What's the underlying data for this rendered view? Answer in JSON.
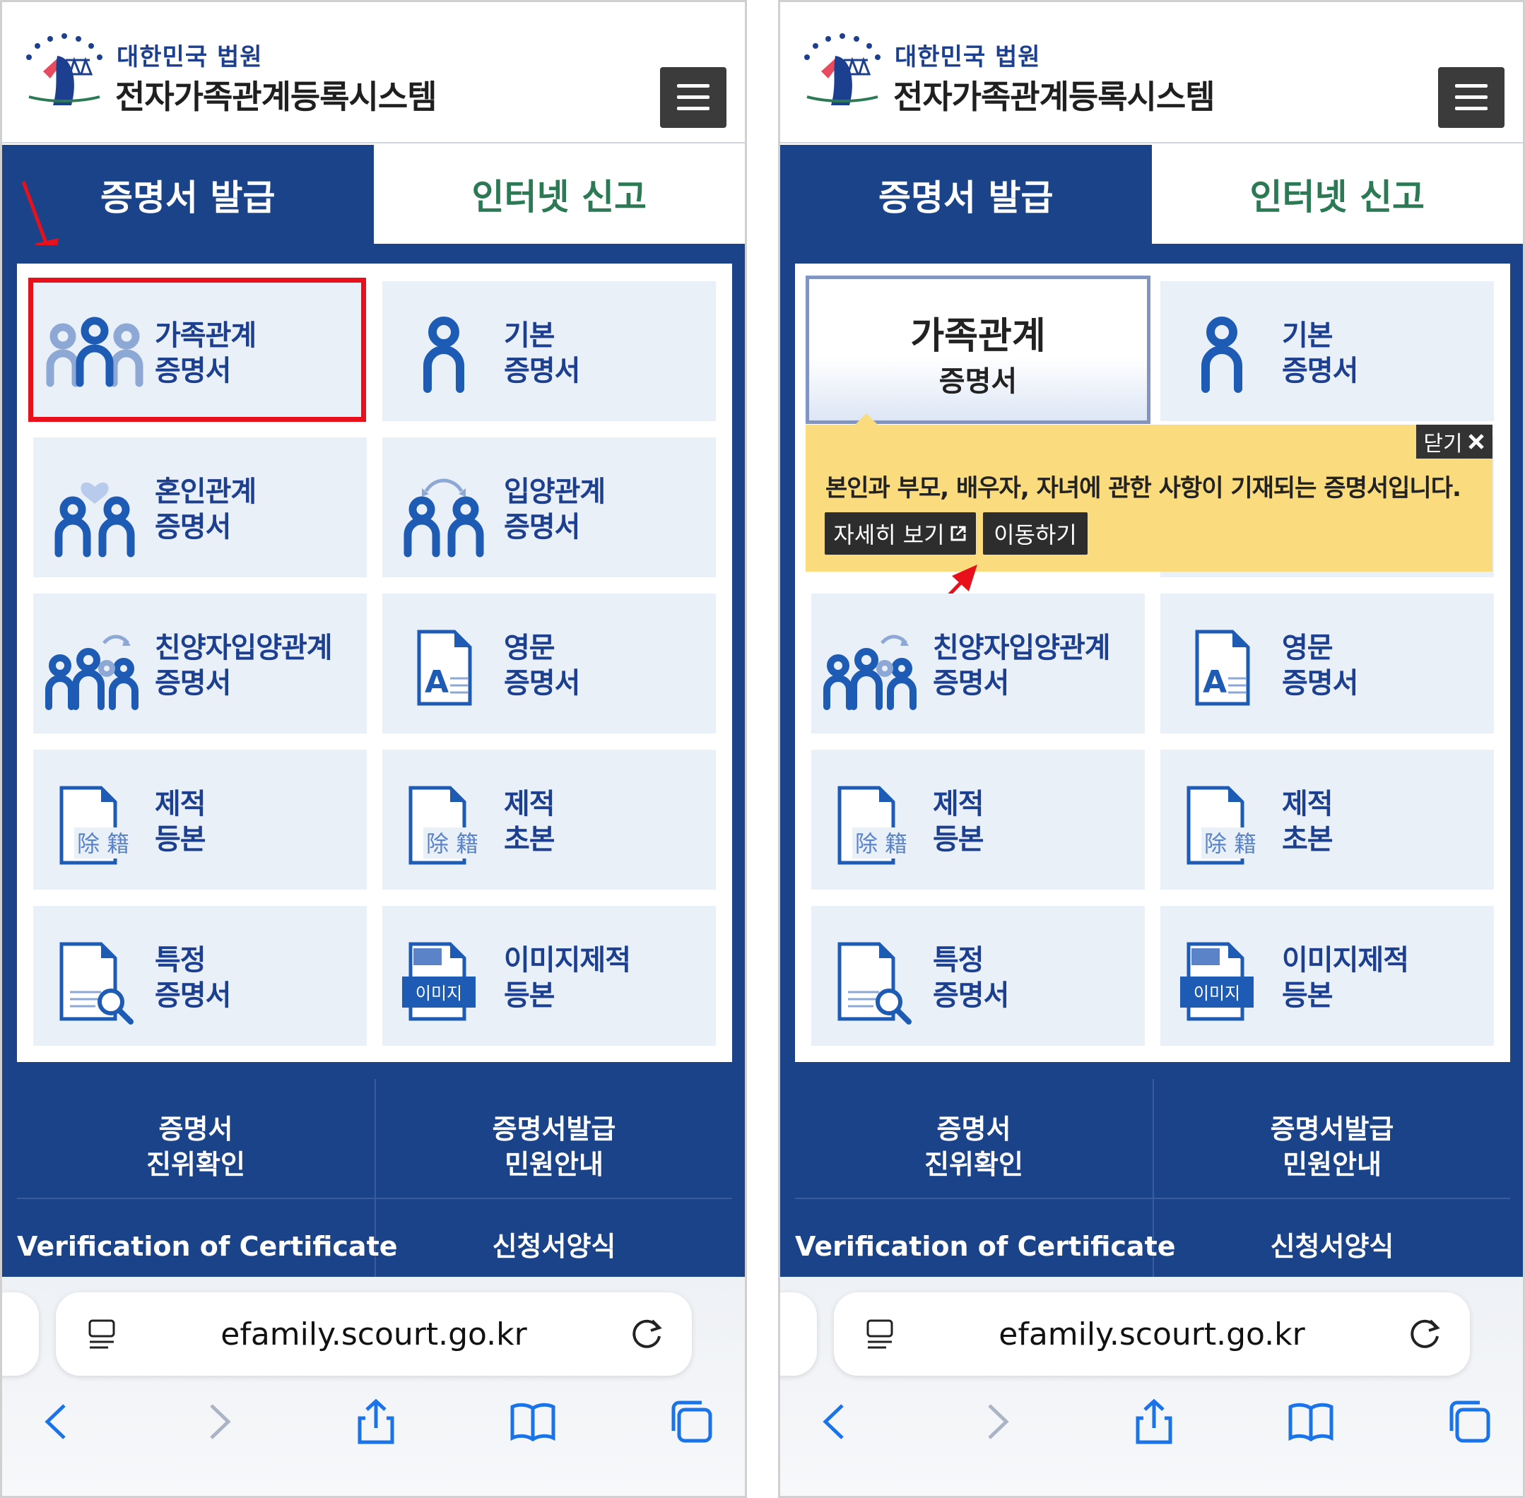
{
  "header": {
    "org_name": "대한민국 법원",
    "system_name": "전자가족관계등록시스템"
  },
  "tabs": [
    {
      "label": "증명서 발급",
      "active": true
    },
    {
      "label": "인터넷 신고",
      "active": false
    }
  ],
  "tiles": [
    {
      "label": "가족관계\n증명서",
      "icon": "family-icon"
    },
    {
      "label": "기본\n증명서",
      "icon": "person-icon"
    },
    {
      "label": "혼인관계\n증명서",
      "icon": "marriage-icon"
    },
    {
      "label": "입양관계\n증명서",
      "icon": "adoption-icon"
    },
    {
      "label": "친양자입양관계\n증명서",
      "icon": "full-adoption-icon"
    },
    {
      "label": "영문\n증명서",
      "icon": "english-doc-icon"
    },
    {
      "label": "제적\n등본",
      "icon": "removed-register-icon"
    },
    {
      "label": "제적\n초본",
      "icon": "removed-register-icon"
    },
    {
      "label": "특정\n증명서",
      "icon": "search-doc-icon"
    },
    {
      "label": "이미지제적\n등본",
      "icon": "image-register-icon"
    }
  ],
  "register_glyph": "除 籍",
  "image_badge": "이미지",
  "selected_tile": {
    "title": "가족관계",
    "subtitle": "증명서"
  },
  "tooltip": {
    "close_label": "닫기",
    "description": "본인과 부모, 배우자, 자녀에 관한 사항이 기재되는 증명서입니다.",
    "detail_button": "자세히 보기",
    "go_button": "이동하기"
  },
  "bottom_links": {
    "verify_cert": "증명서\n진위확인",
    "cert_guide": "증명서발급\n민원안내",
    "verification_en": "Verification of Certificate",
    "application_forms": "신청서양식"
  },
  "browser": {
    "url": "efamily.scourt.go.kr"
  },
  "colors": {
    "navy": "#1b4389",
    "tile_bg": "#eaf0f7",
    "inactive_tab_text": "#2c7a55",
    "highlight_red": "#e8111b",
    "tooltip_yellow": "#fadb7e"
  }
}
